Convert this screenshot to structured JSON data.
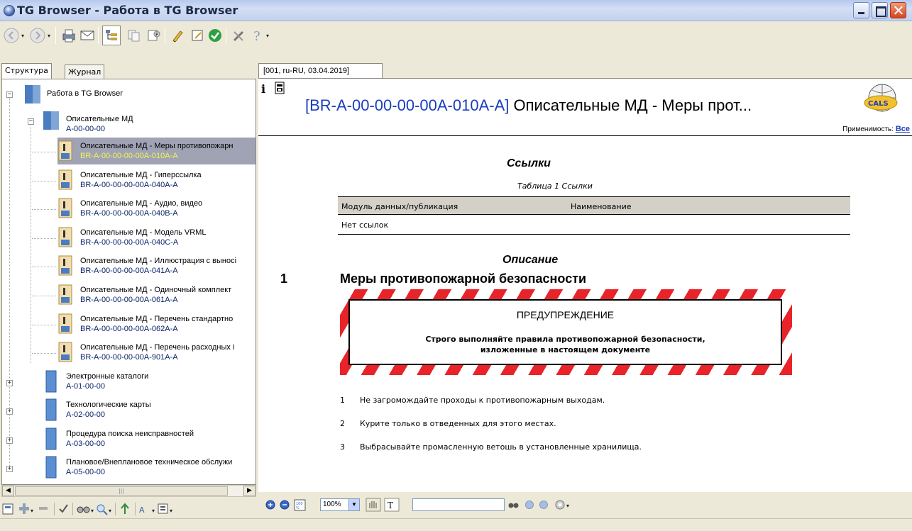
{
  "window": {
    "title": "TG Browser - Работа в TG Browser"
  },
  "left_tabs": {
    "structure": "Структура",
    "journal": "Журнал"
  },
  "tree": {
    "root": {
      "label": "Работа в TG Browser"
    },
    "group": {
      "label": "Описательные МД",
      "code": "A-00-00-00"
    },
    "modules": [
      {
        "label": "Описательные МД - Меры противопожарн",
        "code": "BR-A-00-00-00-00A-010A-A",
        "selected": true
      },
      {
        "label": "Описательные МД - Гиперссылка",
        "code": "BR-A-00-00-00-00A-040A-A"
      },
      {
        "label": "Описательные МД - Аудио, видео",
        "code": "BR-A-00-00-00-00A-040B-A"
      },
      {
        "label": "Описательные МД - Модель VRML",
        "code": "BR-A-00-00-00-00A-040C-A"
      },
      {
        "label": "Описательные МД - Иллюстрация с выносі",
        "code": "BR-A-00-00-00-00A-041A-A"
      },
      {
        "label": "Описательные МД - Одиночный комплект",
        "code": "BR-A-00-00-00-00A-061A-A"
      },
      {
        "label": "Описательные МД - Перечень стандартно",
        "code": "BR-A-00-00-00-00A-062A-A"
      },
      {
        "label": "Описательные МД - Перечень расходных і",
        "code": "BR-A-00-00-00-00A-901A-A"
      }
    ],
    "books": [
      {
        "label": "Электронные каталоги",
        "code": "A-01-00-00"
      },
      {
        "label": "Технологические карты",
        "code": "A-02-00-00"
      },
      {
        "label": "Процедура поиска неисправностей",
        "code": "A-03-00-00"
      },
      {
        "label": "Плановое/Внеплановое техническое обслужи",
        "code": "A-05-00-00"
      }
    ]
  },
  "content": {
    "tab_label": "[001, ru-RU, 03.04.2019]",
    "dm_code": "[BR-A-00-00-00-00A-010A-A]",
    "dm_title": " Описательные МД - Меры прот...",
    "applicability_label": "Применимость:",
    "applicability_value": "Все",
    "refs_title": "Ссылки",
    "refs_caption": "Таблица 1   Ссылки",
    "refs_columns": [
      "Модуль данных/публикация",
      "Наименование"
    ],
    "refs_empty": "Нет ссылок",
    "desc_title": "Описание",
    "step_number": "1",
    "step_title": "Меры противопожарной безопасности",
    "warning": {
      "heading": "ПРЕДУПРЕЖДЕНИЕ",
      "line1": "Строго выполняйте правила противопожарной безопасности,",
      "line2": "изложенные в настоящем документе"
    },
    "items": [
      {
        "num": "1",
        "text": "Не загромождайте проходы к противопожарным выходам."
      },
      {
        "num": "2",
        "text": "Курите только в отведенных для этого местах."
      },
      {
        "num": "3",
        "text": "Выбрасывайте промасленную ветошь в установленные хранилища."
      }
    ]
  },
  "content_toolbar": {
    "zoom": "100%",
    "search_value": ""
  },
  "colors": {
    "link": "#1b3fbd",
    "selection": "#9fa3b4",
    "selected_code": "#f4f44c",
    "warning_stripe": "#e8242a"
  },
  "icons": {
    "toolbar": [
      "back-icon",
      "forward-icon",
      "print-icon",
      "email-icon",
      "tree-toggle-icon",
      "copy-icon",
      "properties-icon",
      "pen-icon",
      "edit-note-icon",
      "check-icon",
      "tools-icon",
      "help-icon"
    ],
    "left_bottom": [
      "page-icon",
      "add-icon",
      "remove-icon",
      "checkmark-icon",
      "binoculars-icon",
      "search-icon",
      "export-icon",
      "font-icon",
      "filter-icon"
    ],
    "content_bottom": [
      "zoom-in-icon",
      "zoom-out-icon",
      "fit-page-icon",
      "hand-icon",
      "text-select-icon",
      "find-icon",
      "prev-hit-icon",
      "next-hit-icon",
      "options-icon"
    ]
  }
}
